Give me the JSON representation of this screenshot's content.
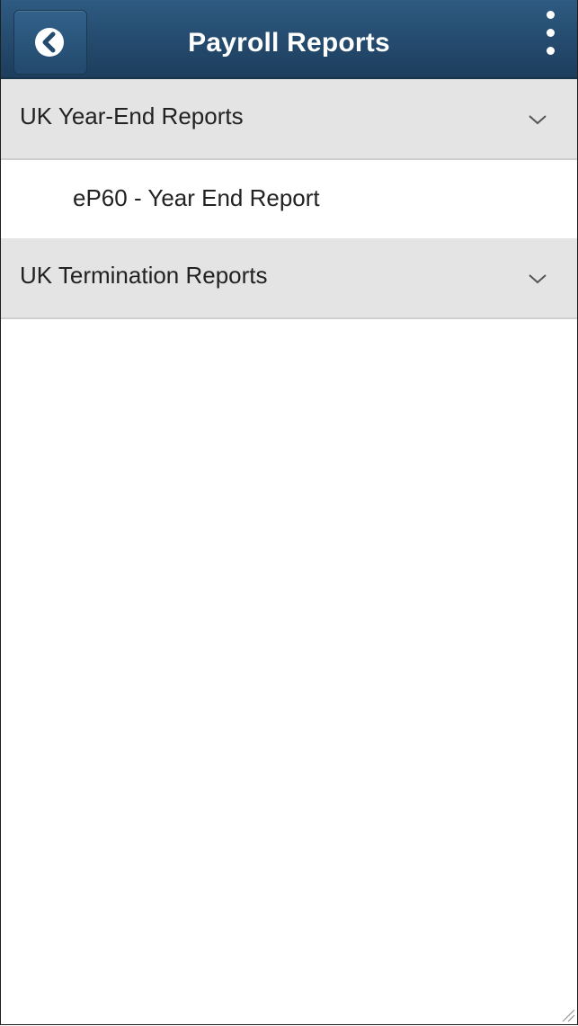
{
  "header": {
    "title": "Payroll Reports",
    "back_icon": "back-chevron-icon",
    "menu_icon": "vertical-ellipsis-icon"
  },
  "groups": [
    {
      "label": "UK Year-End Reports",
      "icon": "chevron-down-icon",
      "items": [
        {
          "label": "eP60 - Year End Report"
        }
      ]
    },
    {
      "label": "UK Termination Reports",
      "icon": "chevron-down-icon",
      "items": []
    }
  ],
  "colors": {
    "header_bg": "#244a6d",
    "group_bg": "#e4e4e4",
    "text": "#222222"
  }
}
